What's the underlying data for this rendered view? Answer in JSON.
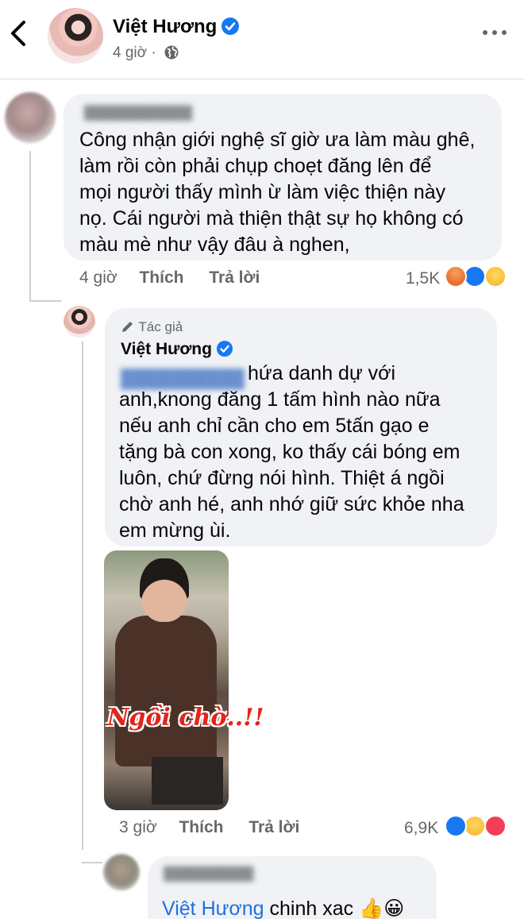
{
  "header": {
    "page_name": "Việt Hương",
    "post_time": "4 giờ ·"
  },
  "comments": [
    {
      "text": "Công nhận giới nghệ sĩ giờ ưa làm màu ghê, làm rồi còn phải chụp choẹt đăng lên để mọi người thấy mình ừ làm việc thiện này nọ. Cái người mà thiện thật sự họ không có màu mè như vậy đâu à nghen,",
      "lines": [
        "Công nhận giới nghệ sĩ giờ ưa làm màu ghê,",
        "làm rồi còn phải chụp choẹt đăng lên để",
        "mọi người thấy mình ừ làm việc thiện này",
        "nọ. Cái người mà thiện thật sự họ không có",
        "màu mè như vậy đâu à nghen,"
      ],
      "time": "4 giờ",
      "like_label": "Thích",
      "reply_label": "Trả lời",
      "reaction_count": "1,5K"
    },
    {
      "author_badge": "Tác giả",
      "author_name": "Việt Hương",
      "lines": [
        "hứa danh dự với",
        "anh,knong đăng 1 tấm hình nào nữa",
        "nếu anh chỉ cần cho em 5tấn gạo e",
        "tặng bà con xong, ko thấy cái bóng em",
        "luôn, chứ đừng nói hình. Thiệt á ngồi",
        "chờ anh hé, anh nhớ giữ sức khỏe nha",
        "em mừng ùi."
      ],
      "photo_caption": "Ngồi chờ..!!",
      "time": "3 giờ",
      "like_label": "Thích",
      "reply_label": "Trả lời",
      "reaction_count": "6,9K"
    },
    {
      "mention": "Việt Hương",
      "text": "chinh xac",
      "emoji": "👍😀"
    }
  ],
  "colors": {
    "accent": "#1877f2",
    "mention": "#216fdb",
    "bubble": "#f0f2f5",
    "meta": "#65676b"
  }
}
